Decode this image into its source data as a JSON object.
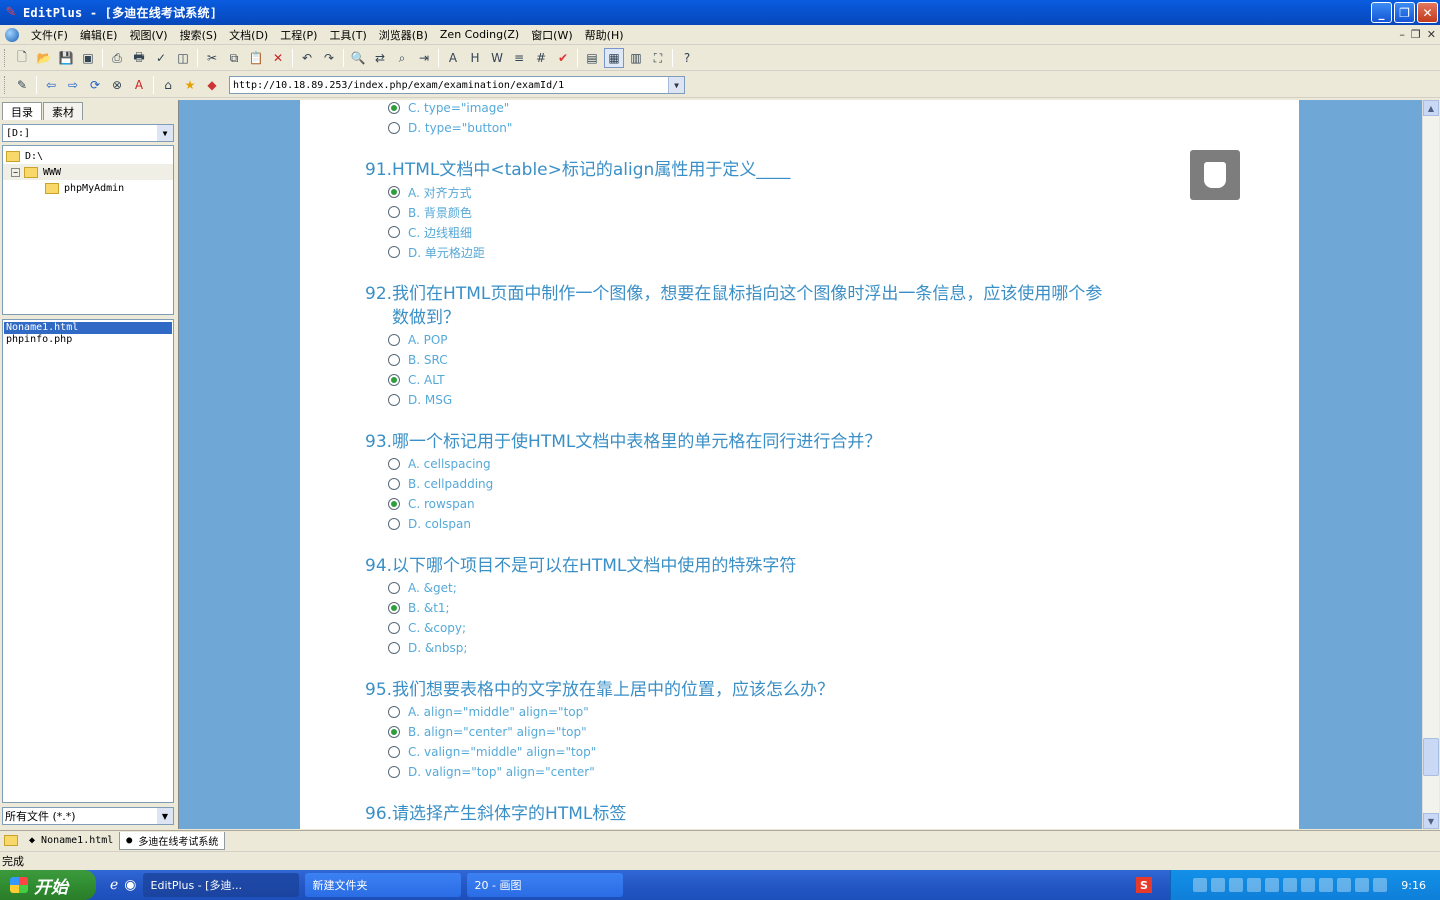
{
  "window": {
    "title": "EditPlus - [多迪在线考试系统]",
    "btn_min": "_",
    "btn_max": "❐",
    "btn_close": "✕"
  },
  "menu": [
    "文件(F)",
    "编辑(E)",
    "视图(V)",
    "搜索(S)",
    "文档(D)",
    "工程(P)",
    "工具(T)",
    "浏览器(B)",
    "Zen Coding(Z)",
    "窗口(W)",
    "帮助(H)"
  ],
  "mdi": {
    "min": "–",
    "restore": "❐",
    "close": "✕"
  },
  "address": {
    "url": "http://10.18.89.253/index.php/exam/examination/examId/1"
  },
  "left_panel": {
    "tabs": [
      "目录",
      "素材"
    ],
    "drive": "[D:]",
    "tree": [
      "D:\\",
      "WWW",
      "phpMyAdmin"
    ],
    "files": [
      "Noname1.html",
      "phpinfo.php"
    ],
    "filter": "所有文件 (*.*)"
  },
  "exam": {
    "prev_options": [
      {
        "label": "C. type=\"image\"",
        "selected": true
      },
      {
        "label": "D. type=\"button\"",
        "selected": false
      }
    ],
    "questions": [
      {
        "title": "91.HTML文档中<table>标记的align属性用于定义____",
        "options": [
          {
            "label": "A. 对齐方式",
            "selected": true
          },
          {
            "label": "B. 背景颜色",
            "selected": false
          },
          {
            "label": "C. 边线粗细",
            "selected": false
          },
          {
            "label": "D. 单元格边距",
            "selected": false
          }
        ]
      },
      {
        "title_line1": "92.我们在HTML页面中制作一个图像，想要在鼠标指向这个图像时浮出一条信息，应该使用哪个参",
        "title_line2": "数做到？",
        "options": [
          {
            "label": "A. POP",
            "selected": false
          },
          {
            "label": "B. SRC",
            "selected": false
          },
          {
            "label": "C. ALT",
            "selected": true
          },
          {
            "label": "D. MSG",
            "selected": false
          }
        ]
      },
      {
        "title": "93.哪一个标记用于使HTML文档中表格里的单元格在同行进行合并？",
        "options": [
          {
            "label": "A. cellspacing",
            "selected": false
          },
          {
            "label": "B. cellpadding",
            "selected": false
          },
          {
            "label": "C. rowspan",
            "selected": true
          },
          {
            "label": "D. colspan",
            "selected": false
          }
        ]
      },
      {
        "title": "94.以下哪个项目不是可以在HTML文档中使用的特殊字符",
        "options": [
          {
            "label": "A. &get;",
            "selected": false
          },
          {
            "label": "B. &t1;",
            "selected": true
          },
          {
            "label": "C. &copy;",
            "selected": false
          },
          {
            "label": "D. &nbsp;",
            "selected": false
          }
        ]
      },
      {
        "title": "95.我们想要表格中的文字放在靠上居中的位置，应该怎么办？",
        "options": [
          {
            "label": "A. align=\"middle\" align=\"top\"",
            "selected": false
          },
          {
            "label": "B. align=\"center\" align=\"top\"",
            "selected": true
          },
          {
            "label": "C. valign=\"middle\" align=\"top\"",
            "selected": false
          },
          {
            "label": "D. valign=\"top\" align=\"center\"",
            "selected": false
          }
        ]
      },
      {
        "title": "96.请选择产生斜体字的HTML标签"
      }
    ]
  },
  "doc_tabs": [
    "Noname1.html",
    "多迪在线考试系统"
  ],
  "status": "完成",
  "taskbar": {
    "start": "开始",
    "tasks": [
      "EditPlus - [多迪...",
      "新建文件夹",
      "20 - 画图"
    ],
    "ime": "S",
    "clock": "9:16"
  }
}
